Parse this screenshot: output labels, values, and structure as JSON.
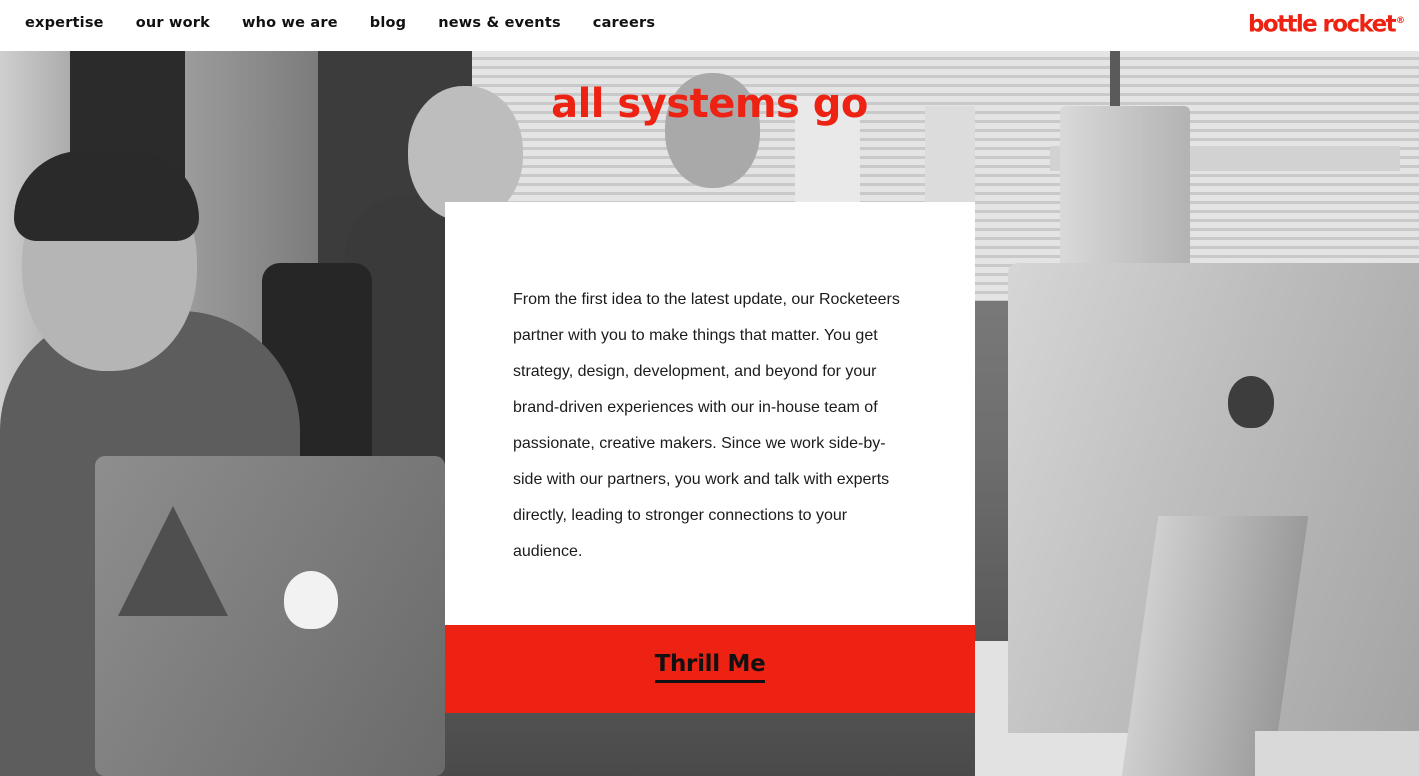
{
  "nav": {
    "items": [
      "expertise",
      "our work",
      "who we are",
      "blog",
      "news & events",
      "careers"
    ]
  },
  "logo": {
    "text": "bottle rocket",
    "mark": "®"
  },
  "hero": {
    "headline": "all systems go",
    "body": "From the first idea to the latest update, our Rocketeers partner with you to make things that matter. You get strategy, design, development, and beyond for your brand-driven experiences with our in-house team of passionate, creative makers. Since we work side-by-side with our partners, you work and talk with experts directly, leading to stronger connections to your audience.",
    "cta_label": "Thrill Me"
  },
  "colors": {
    "accent": "#ee2212",
    "text": "#111111",
    "card_bg": "#ffffff"
  }
}
